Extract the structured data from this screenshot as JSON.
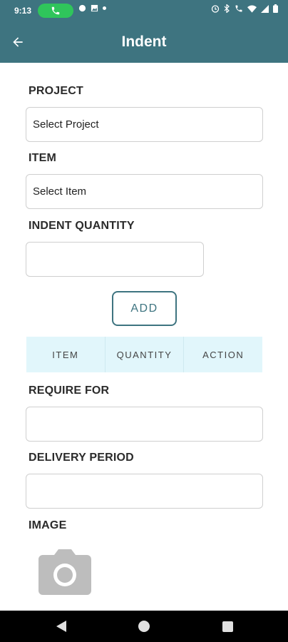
{
  "status_bar": {
    "time": "9:13",
    "icons": [
      "phone-call-icon",
      "notification-icon",
      "image-icon",
      "dot-icon",
      "alarm-icon",
      "bluetooth-icon",
      "wifi-calling-icon",
      "wifi-icon",
      "signal-icon",
      "battery-icon"
    ]
  },
  "app_bar": {
    "title": "Indent",
    "back_icon": "arrow-left-icon"
  },
  "form": {
    "project_label": "PROJECT",
    "project_value": "Select Project",
    "item_label": "ITEM",
    "item_value": "Select Item",
    "indent_quantity_label": "INDENT QUANTITY",
    "indent_quantity_value": "",
    "add_label": "ADD",
    "table_headers": [
      "ITEM",
      "QUANTITY",
      "ACTION"
    ],
    "require_for_label": "REQUIRE FOR",
    "require_for_value": "",
    "delivery_period_label": "DELIVERY PERIOD",
    "delivery_period_value": "",
    "image_label": "IMAGE",
    "image_icon": "camera-icon"
  },
  "nav_bar": {
    "icons": [
      "back-triangle-icon",
      "home-circle-icon",
      "recents-square-icon"
    ]
  },
  "colors": {
    "primary": "#3e7480",
    "table_header_bg": "#e1f6fb",
    "call_pill": "#2fc55b"
  }
}
